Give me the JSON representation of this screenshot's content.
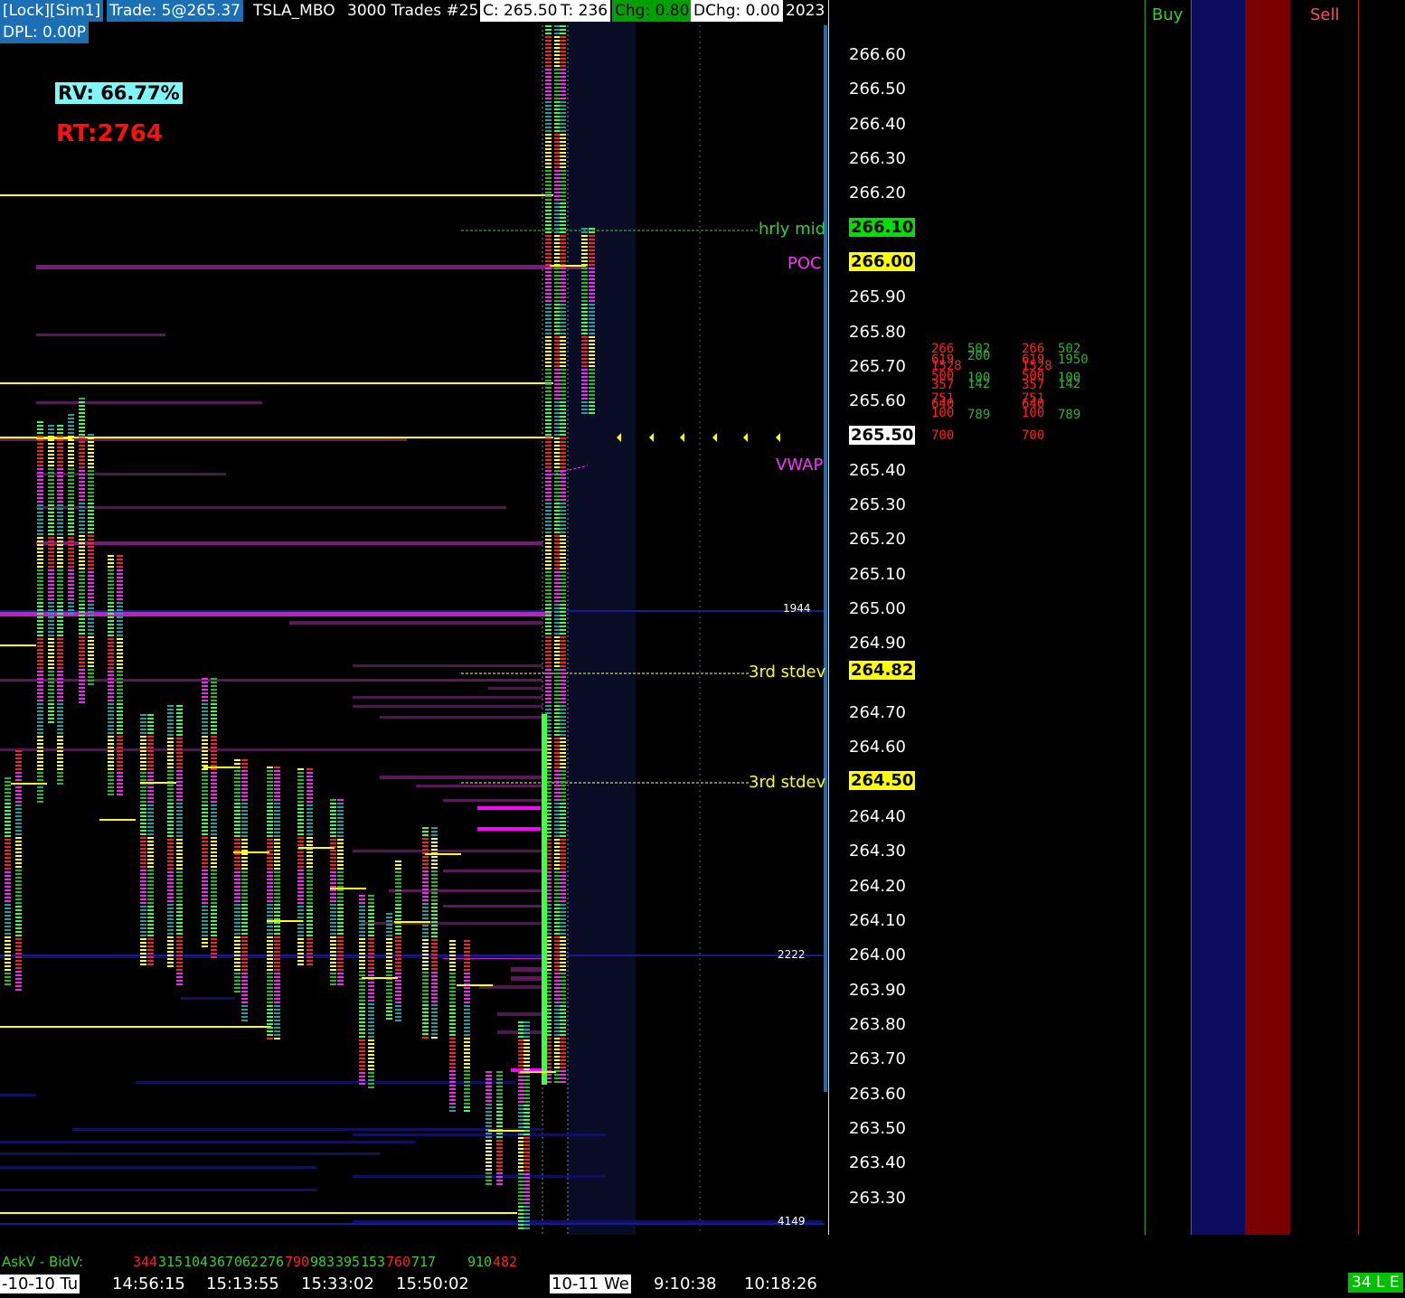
{
  "header": {
    "account": "[Lock][Sim1]",
    "trade": "Trade: 5@265.37",
    "symbol": "TSLA_MBO",
    "trades": "3000 Trades #25",
    "close": "C: 265.50",
    "ticks": "T: 236",
    "chg": "Chg: 0.80",
    "dchg": "DChg: 0.00",
    "year": "2023",
    "dpl": "DPL: 0.00P"
  },
  "stats": {
    "rv": "RV:  66.77%",
    "rt": "RT:2764"
  },
  "price_axis": {
    "ticks": [
      "266.60",
      "266.50",
      "266.40",
      "266.30",
      "266.20",
      "265.90",
      "265.80",
      "265.70",
      "265.60",
      "265.40",
      "265.30",
      "265.20",
      "265.10",
      "265.00",
      "264.90",
      "264.70",
      "264.60",
      "264.40",
      "264.30",
      "264.20",
      "264.10",
      "264.00",
      "263.90",
      "263.80",
      "263.70",
      "263.60",
      "263.50",
      "263.40",
      "263.30"
    ],
    "tags": {
      "hrly_mid": "266.10",
      "poc": "266.00",
      "last": "265.50",
      "stdev_upper": "264.82",
      "stdev_lower": "264.50"
    }
  },
  "annotations": {
    "hrly_mid": "hrly mid",
    "poc": "POC",
    "vwap": "VWAP",
    "stdev1": "3rd stdev",
    "stdev2": "3rd stdev",
    "vol_marker_top": "1944",
    "vol_marker_mid": "2222",
    "vol_marker_bot": "4149"
  },
  "time_axis": [
    "-10-10 Tu",
    "14:56:15",
    "15:13:55",
    "15:33:02",
    "15:50:02",
    "10-11 We",
    "9:10:38",
    "10:18:26"
  ],
  "askbid": {
    "label": "AskV - BidV:",
    "values": [
      {
        "text": "344",
        "color": "#ff2020"
      },
      {
        "text": "315",
        "color": "#30d030"
      },
      {
        "text": "104",
        "color": "#30d030"
      },
      {
        "text": "367",
        "color": "#30d030"
      },
      {
        "text": "062",
        "color": "#30d030"
      },
      {
        "text": "276",
        "color": "#30d030"
      },
      {
        "text": "790",
        "color": "#ff2020"
      },
      {
        "text": "983",
        "color": "#30d030"
      },
      {
        "text": "395",
        "color": "#30d030"
      },
      {
        "text": "153",
        "color": "#30d030"
      },
      {
        "text": "760",
        "color": "#ff2020"
      },
      {
        "text": "717",
        "color": "#30d030"
      },
      {
        "text": "",
        "color": "#00ff00"
      },
      {
        "text": "910",
        "color": "#30d030"
      },
      {
        "text": "482",
        "color": "#ff2020"
      }
    ]
  },
  "dom": {
    "left_red": [
      "266",
      "619",
      "1528",
      "500",
      "357",
      "751",
      "640",
      "100",
      "700"
    ],
    "left_green": [
      "502",
      "200",
      "100",
      "142",
      "789"
    ],
    "right_red": [
      "266",
      "619",
      "1528",
      "500",
      "357",
      "751",
      "640",
      "100",
      "700"
    ],
    "right_green": [
      "502",
      "1950",
      "100",
      "142",
      "789"
    ]
  },
  "order_panel": {
    "buy": "Buy",
    "sell": "Sell",
    "status": "34 L E"
  },
  "colors": {
    "accent_blue": "#1a6fb5",
    "buy_col": "#0b0b60",
    "sell_col": "#7a0000",
    "yellow": "#ffff00",
    "magenta": "#ff00ff"
  }
}
